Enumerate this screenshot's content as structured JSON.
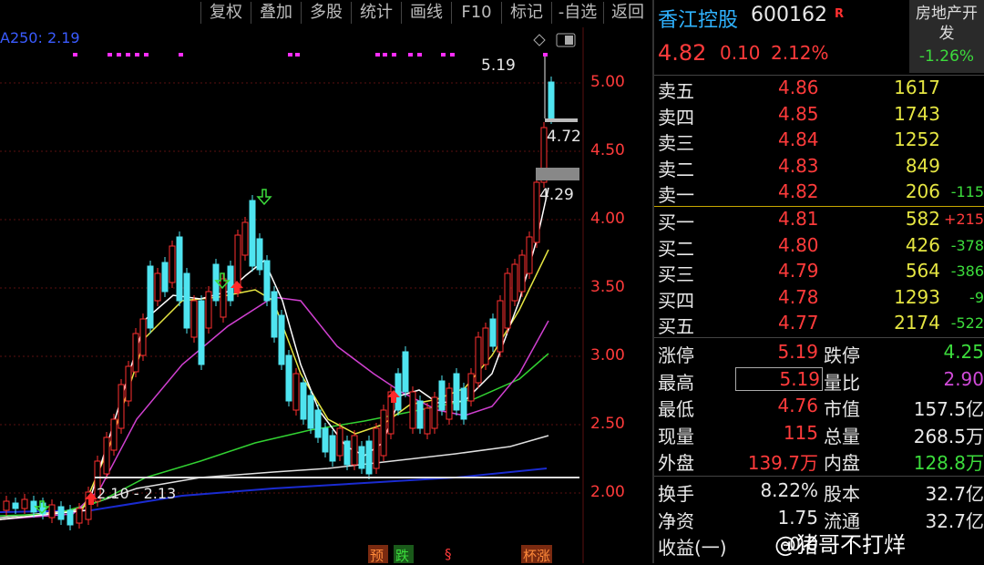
{
  "toolbar": [
    "复权",
    "叠加",
    "多股",
    "统计",
    "画线",
    "F10",
    "标记",
    "-自选",
    "返回"
  ],
  "ma_label": "A250: 2.19",
  "price_axis": [
    "5.00",
    "4.50",
    "4.00",
    "3.50",
    "3.00",
    "2.50",
    "2.00"
  ],
  "annotations": {
    "high": "5.19",
    "level1": "4.72",
    "level2": "4.29",
    "range": "2.10 - 2.13"
  },
  "bottom_marks": [
    "预",
    "跌",
    "§",
    "杯涨"
  ],
  "stock": {
    "name": "香江控股",
    "code": "600162",
    "flag": "R",
    "price": "4.82",
    "change": "0.10",
    "pct": "2.12%"
  },
  "sector": {
    "name": "房地产开发",
    "change": "-1.26%"
  },
  "asks": [
    {
      "label": "卖五",
      "price": "4.86",
      "vol": "1617",
      "delta": ""
    },
    {
      "label": "卖四",
      "price": "4.85",
      "vol": "1743",
      "delta": ""
    },
    {
      "label": "卖三",
      "price": "4.84",
      "vol": "1252",
      "delta": ""
    },
    {
      "label": "卖二",
      "price": "4.83",
      "vol": "849",
      "delta": ""
    },
    {
      "label": "卖一",
      "price": "4.82",
      "vol": "206",
      "delta": "-115"
    }
  ],
  "bids": [
    {
      "label": "买一",
      "price": "4.81",
      "vol": "582",
      "delta": "+215"
    },
    {
      "label": "买二",
      "price": "4.80",
      "vol": "426",
      "delta": "-378"
    },
    {
      "label": "买三",
      "price": "4.79",
      "vol": "564",
      "delta": "-386"
    },
    {
      "label": "买四",
      "price": "4.78",
      "vol": "1293",
      "delta": "-9"
    },
    {
      "label": "买五",
      "price": "4.77",
      "vol": "2174",
      "delta": "-522"
    }
  ],
  "stats": [
    {
      "l1": "涨停",
      "v1": "5.19",
      "l2": "跌停",
      "v2": "4.25"
    },
    {
      "l1": "最高",
      "v1": "5.19",
      "l2": "量比",
      "v2": "2.90"
    },
    {
      "l1": "最低",
      "v1": "4.76",
      "l2": "市值",
      "v2": "157.5亿"
    },
    {
      "l1": "现量",
      "v1": "115",
      "l2": "总量",
      "v2": "268.5万"
    },
    {
      "l1": "外盘",
      "v1": "139.7万",
      "l2": "内盘",
      "v2": "128.8万"
    }
  ],
  "stats2": [
    {
      "l1": "换手",
      "v1": "8.22%",
      "l2": "股本",
      "v2": "32.7亿"
    },
    {
      "l1": "净资",
      "v1": "1.75",
      "l2": "流通",
      "v2": "32.7亿"
    },
    {
      "l1": "收益(一)",
      "v1": "-0.0",
      "l2": "",
      "v2": ""
    }
  ],
  "watermark": "@猪哥不打烊"
}
